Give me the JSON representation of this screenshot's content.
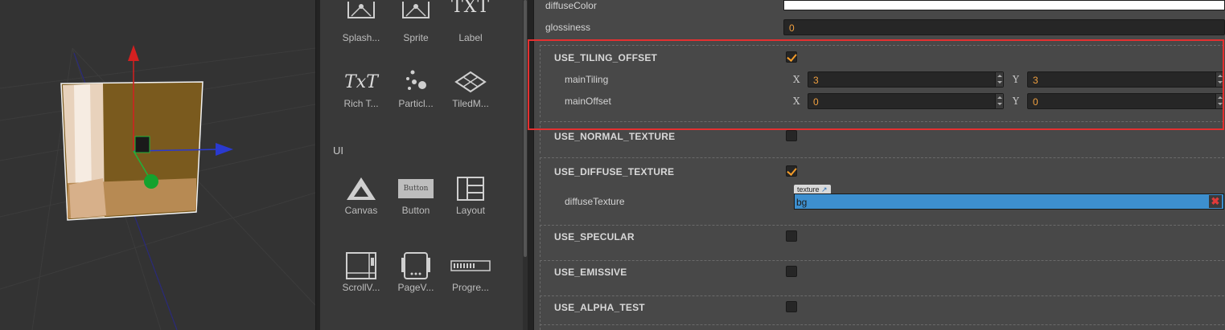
{
  "assets": {
    "items": [
      {
        "label": "Splash...",
        "icon": "splash-sprite-icon"
      },
      {
        "label": "Sprite",
        "icon": "sprite-icon"
      },
      {
        "label": "Label",
        "icon": "label-icon"
      },
      {
        "label": "Rich T...",
        "icon": "rich-text-icon"
      },
      {
        "label": "Particl...",
        "icon": "particle-icon"
      },
      {
        "label": "TiledM...",
        "icon": "tiledmap-icon"
      }
    ],
    "ui_heading": "UI",
    "ui_items": [
      {
        "label": "Canvas",
        "icon": "canvas-icon"
      },
      {
        "label": "Button",
        "icon": "button-icon",
        "icon_text": "Button"
      },
      {
        "label": "Layout",
        "icon": "layout-icon"
      },
      {
        "label": "ScrollV...",
        "icon": "scrollview-icon"
      },
      {
        "label": "PageV...",
        "icon": "pageview-icon"
      },
      {
        "label": "Progre...",
        "icon": "progressbar-icon"
      }
    ],
    "label_icon_text": "TXT",
    "richtext_icon_text": "TxT"
  },
  "inspector": {
    "diffuse_color_label": "diffuseColor",
    "glossiness_label": "glossiness",
    "glossiness_value": "0",
    "sections": {
      "tiling": {
        "title": "USE_TILING_OFFSET",
        "checked": true
      },
      "normal": {
        "title": "USE_NORMAL_TEXTURE",
        "checked": false
      },
      "diffuse": {
        "title": "USE_DIFFUSE_TEXTURE",
        "checked": true
      },
      "specular": {
        "title": "USE_SPECULAR",
        "checked": false
      },
      "emissive": {
        "title": "USE_EMISSIVE",
        "checked": false
      },
      "alpha": {
        "title": "USE_ALPHA_TEST",
        "checked": false
      }
    },
    "main_tiling": {
      "label": "mainTiling",
      "x_axis": "X",
      "y_axis": "Y",
      "x": "3",
      "y": "3"
    },
    "main_offset": {
      "label": "mainOffset",
      "x_axis": "X",
      "y_axis": "Y",
      "x": "0",
      "y": "0"
    },
    "diffuse_texture": {
      "label": "diffuseTexture",
      "tag": "texture",
      "value": "bg",
      "remove": "✖"
    }
  },
  "colors": {
    "accent": "#f39c2a",
    "highlight": "#e53030",
    "texture_field": "#3d8fcf"
  }
}
